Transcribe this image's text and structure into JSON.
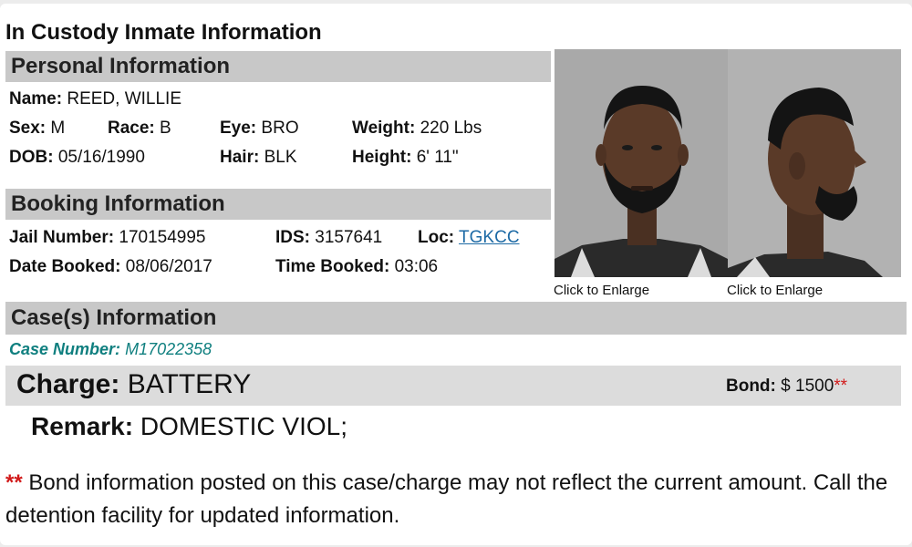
{
  "page_title": "In Custody Inmate Information",
  "personal": {
    "header": "Personal Information",
    "name_label": "Name:",
    "name": "REED, WILLIE",
    "sex_label": "Sex:",
    "sex": "M",
    "race_label": "Race:",
    "race": "B",
    "eye_label": "Eye:",
    "eye": "BRO",
    "weight_label": "Weight:",
    "weight": "220 Lbs",
    "dob_label": "DOB:",
    "dob": "05/16/1990",
    "hair_label": "Hair:",
    "hair": "BLK",
    "height_label": "Height:",
    "height": "6'  11\""
  },
  "booking": {
    "header": "Booking Information",
    "jail_label": "Jail Number:",
    "jail": "170154995",
    "ids_label": "IDS:",
    "ids": "3157641",
    "loc_label": "Loc:",
    "loc": "TGKCC",
    "date_label": "Date Booked:",
    "date": "08/06/2017",
    "time_label": "Time Booked:",
    "time": "03:06"
  },
  "photos": {
    "front_caption": "Click to Enlarge",
    "side_caption": "Click to Enlarge"
  },
  "cases": {
    "header": "Case(s) Information",
    "case_number_label": "Case Number:",
    "case_number": "M17022358",
    "charge_label": "Charge:",
    "charge": "BATTERY",
    "bond_label": "Bond:",
    "bond": "$ 1500",
    "bond_marker": "**",
    "remark_label": "Remark:",
    "remark": "DOMESTIC VIOL;"
  },
  "footnote": {
    "marker": "**",
    "text": "Bond information posted on this case/charge may not reflect the current amount. Call the detention facility for updated information."
  }
}
